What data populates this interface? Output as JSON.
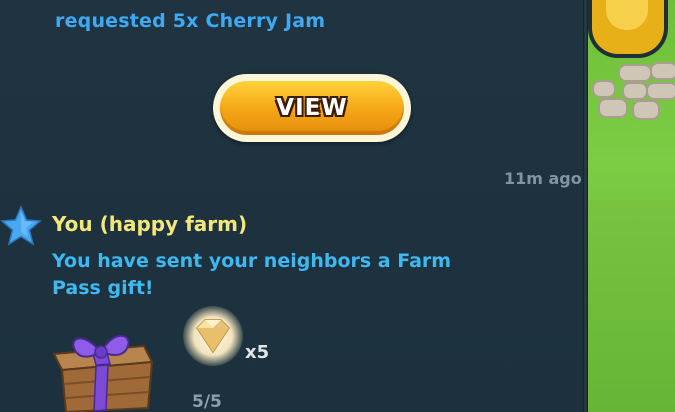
{
  "feed": {
    "request_text": "requested 5x Cherry Jam",
    "view_button_label": "VIEW",
    "timestamp": "11m ago",
    "author": "You (happy farm)",
    "message": "You have sent your neighbors a Farm Pass gift!",
    "reward_count": "x5",
    "progress": "5/5"
  },
  "icons": {
    "star": "star-icon",
    "gift": "gift-box-icon",
    "gem": "diamond-icon"
  },
  "colors": {
    "background": "#1e3340",
    "request_text": "#3fa9f5",
    "author_text": "#f2e77a",
    "message_text": "#3fb7f0",
    "button": "#f4a516"
  }
}
